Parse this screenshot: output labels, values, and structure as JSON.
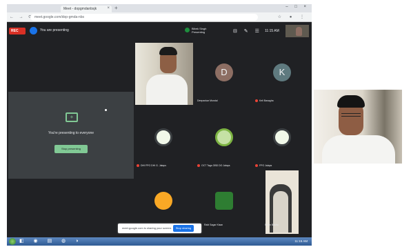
{
  "browser": {
    "tab_title": "Meet - dopgmdanbsjk",
    "tab_close": "×",
    "new_tab": "+",
    "window_controls": "– □ ×",
    "nav_icons": "← → ⟳",
    "url": "meet.google.com/dop-gmda-nbs",
    "extension_icons": "☆ ● ⋮"
  },
  "meet": {
    "rec_label": "REC",
    "presenting_label": "You are presenting",
    "presenter_name": "Bibek Singh",
    "presenter_sub": "Presenting",
    "toolbar_icons": "⊟ ✎ ☰",
    "time": "11:15 AM",
    "present_icon": "+",
    "present_message": "You're presenting to everyone",
    "stop_presenting_label": "Stop presenting",
    "share_notice": "meet.google.com is sharing your screen.",
    "share_stop_label": "Stop sharing"
  },
  "participants": [
    {
      "name": "Deepankar Mondal",
      "initial": "D",
      "color": "#8d6e63"
    },
    {
      "name": "Keli Basagha",
      "initial": "K",
      "color": "#5f7a7f"
    },
    {
      "name": "DHI FPO DHI G. Jalaps",
      "logo_color": "#f1f8e9"
    },
    {
      "name": "OCT Tags OBD DO Jalaps",
      "logo_color": "#c5e1a5"
    },
    {
      "name": "FPO Jalaps",
      "logo_color": "#f1f8e9"
    },
    {
      "name": "",
      "logo_color": "#f9a825"
    },
    {
      "name": "Rabi Sagar Kisan",
      "logo_color": "#2e7d32"
    },
    {
      "name": "Sulen Basho"
    }
  ],
  "taskbar": {
    "task_icons": "◧ ◉ ▤ ◍ ◑",
    "tray_text": "11:15 AM"
  }
}
